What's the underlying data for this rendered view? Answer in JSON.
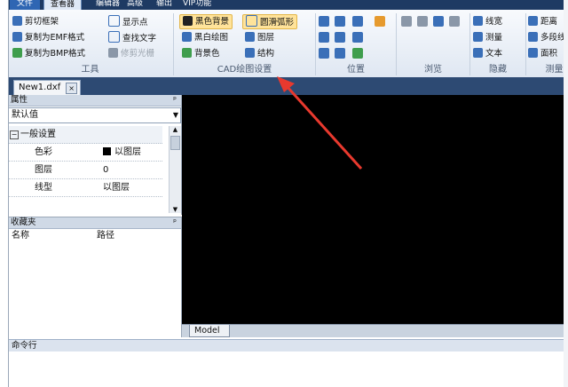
{
  "menu": {
    "file": "文件",
    "active_tab": "查看器",
    "items": [
      "编辑器",
      "高级",
      "输出",
      "VIP功能"
    ]
  },
  "ribbon": {
    "tools": {
      "b1": "剪切框架",
      "b2": "复制为EMF格式",
      "b3": "复制为BMP格式",
      "b4": "显示点",
      "b5": "查找文字",
      "b6": "修剪光栅",
      "label": "工具"
    },
    "cad": {
      "b1": "黑色背景",
      "b2": "圆滑弧形",
      "b3": "黑白绘图",
      "b4": "图层",
      "b5": "背景色",
      "b6": "结构",
      "label": "CAD绘图设置"
    },
    "position": {
      "label": "位置"
    },
    "browse": {
      "label": "浏览"
    },
    "hide": {
      "b1": "线宽",
      "b2": "测量",
      "b3": "文本",
      "label": "隐藏"
    },
    "measure": {
      "b1": "距离",
      "b2": "多段线长",
      "b3": "面积",
      "label": "测量"
    }
  },
  "doc_tab": {
    "name": "New1.dxf",
    "close": "×"
  },
  "properties": {
    "title": "属性",
    "pin": "ᵖ",
    "combo": "默认值",
    "group": "一般设置",
    "rows": [
      {
        "k": "色彩",
        "v": "以图层"
      },
      {
        "k": "图层",
        "v": "0"
      },
      {
        "k": "线型",
        "v": "以图层"
      }
    ]
  },
  "favorites": {
    "title": "收藏夹",
    "pin": "ᵖ",
    "col1": "名称",
    "col2": "路径"
  },
  "model_tab": "Model",
  "command": {
    "label": "命令行"
  },
  "colors": {
    "accent": "#1e3a63",
    "canvas": "#000000",
    "highlight": "#ffe39a",
    "annotation_arrow": "#e8392e"
  }
}
